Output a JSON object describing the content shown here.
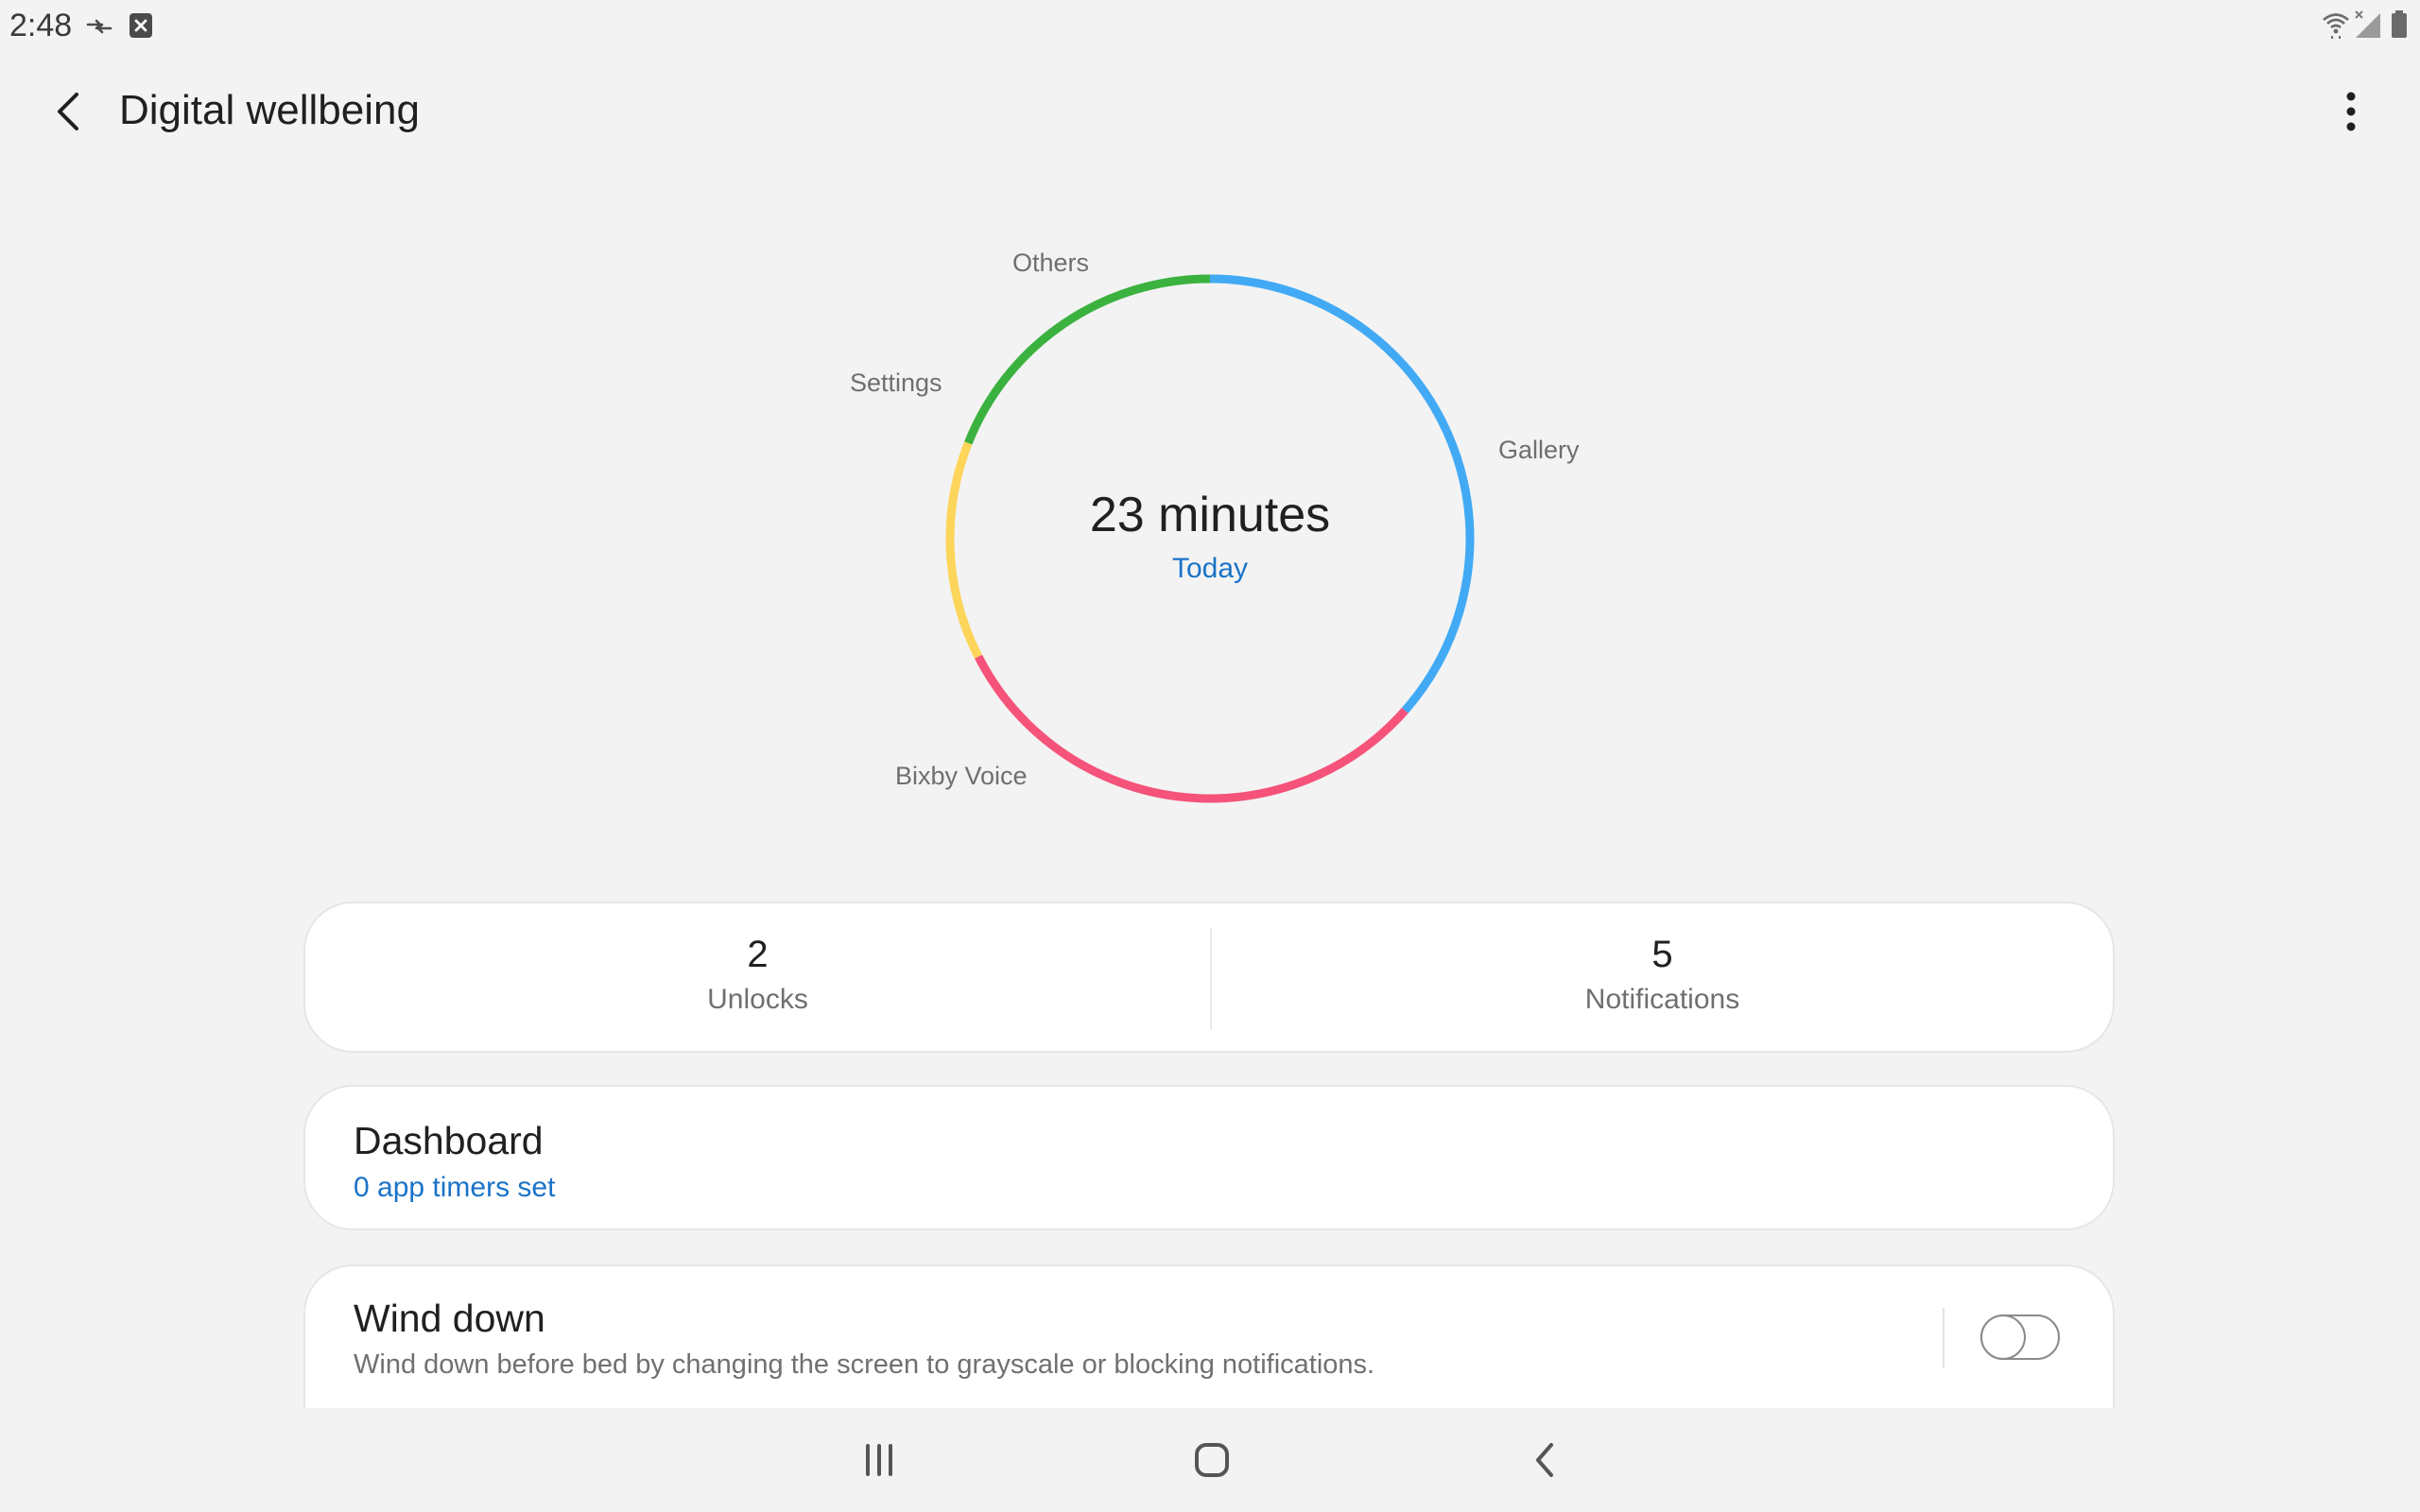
{
  "status_bar": {
    "time": "2:48",
    "left_icons": [
      "data-sync-icon",
      "blocked-notification-icon"
    ],
    "right_icons": [
      "wifi-icon",
      "no-signal-icon",
      "battery-icon"
    ]
  },
  "header": {
    "title": "Digital wellbeing",
    "back_icon": "back-arrow-icon",
    "menu_icon": "more-options-icon"
  },
  "chart_data": {
    "type": "pie",
    "center_value": "23 minutes",
    "center_label": "Today",
    "slices": [
      {
        "label": "Gallery",
        "fraction": 0.365,
        "color": "#42aaf5"
      },
      {
        "label": "Bixby Voice",
        "fraction": 0.31,
        "color": "#f5537a"
      },
      {
        "label": "Settings",
        "fraction": 0.135,
        "color": "#fdd55a"
      },
      {
        "label": "Others",
        "fraction": 0.19,
        "color": "#3bb23f"
      }
    ]
  },
  "stats": {
    "unlocks_value": "2",
    "unlocks_label": "Unlocks",
    "notifications_value": "5",
    "notifications_label": "Notifications"
  },
  "dashboard": {
    "title": "Dashboard",
    "subtitle": "0 app timers set"
  },
  "wind_down": {
    "title": "Wind down",
    "description": "Wind down before bed by changing the screen to grayscale or blocking notifications.",
    "enabled": false
  },
  "navbar": {
    "icons": [
      "recent-apps-icon",
      "home-icon",
      "back-icon"
    ]
  },
  "colors": {
    "accent": "#1a73c8",
    "background": "#f3f3f3"
  }
}
